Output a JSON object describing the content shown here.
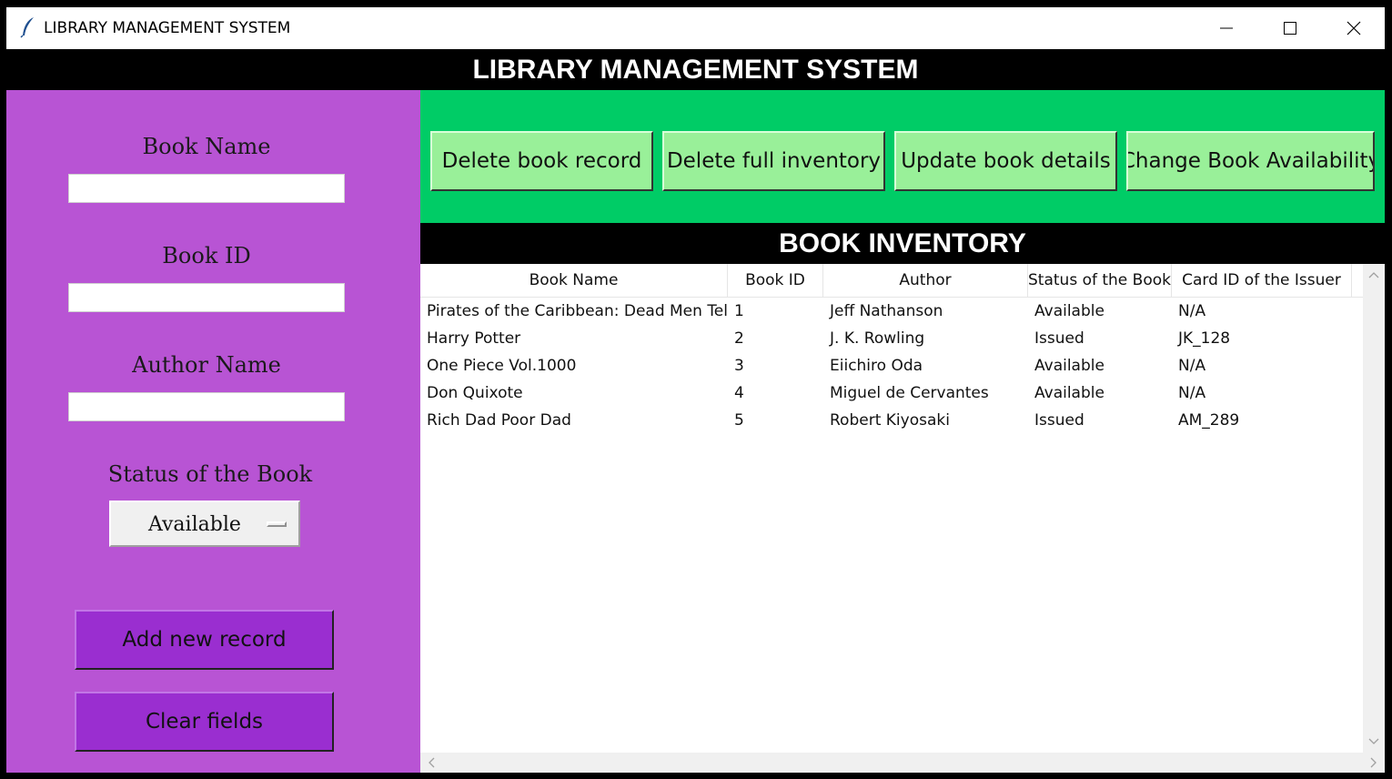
{
  "window": {
    "title": "LIBRARY MANAGEMENT SYSTEM"
  },
  "header": {
    "title": "LIBRARY MANAGEMENT SYSTEM"
  },
  "form": {
    "book_name_label": "Book Name",
    "book_name_value": "",
    "book_id_label": "Book ID",
    "book_id_value": "",
    "author_label": "Author Name",
    "author_value": "",
    "status_label": "Status of the Book",
    "status_value": "Available",
    "add_button": "Add new record",
    "clear_button": "Clear fields"
  },
  "actions": {
    "delete_record": "Delete book record",
    "delete_inventory": "Delete full inventory",
    "update_details": "Update book details",
    "change_availability": "Change Book Availability"
  },
  "inventory": {
    "title": "BOOK INVENTORY",
    "columns": [
      "Book Name",
      "Book ID",
      "Author",
      "Status of the Book",
      "Card ID of the Issuer"
    ],
    "rows": [
      [
        "Pirates of the Caribbean: Dead Men Tell No Tales",
        "1",
        "Jeff Nathanson",
        "Available",
        "N/A"
      ],
      [
        "Harry Potter",
        "2",
        "J. K. Rowling",
        "Issued",
        "JK_128"
      ],
      [
        "One Piece Vol.1000",
        "3",
        "Eiichiro Oda",
        "Available",
        "N/A"
      ],
      [
        "Don Quixote",
        "4",
        "Miguel de Cervantes",
        "Available",
        "N/A"
      ],
      [
        "Rich Dad Poor Dad",
        "5",
        "Robert Kiyosaki",
        "Issued",
        "AM_289"
      ]
    ]
  },
  "icons": {
    "app": "feather-icon",
    "minimize": "minimize-icon",
    "maximize": "maximize-icon",
    "close": "close-icon"
  },
  "colors": {
    "left_panel": "#b854d4",
    "purple_button": "#9a2ed0",
    "top_panel": "#00cc66",
    "green_button": "#99f099",
    "header": "#000000"
  }
}
